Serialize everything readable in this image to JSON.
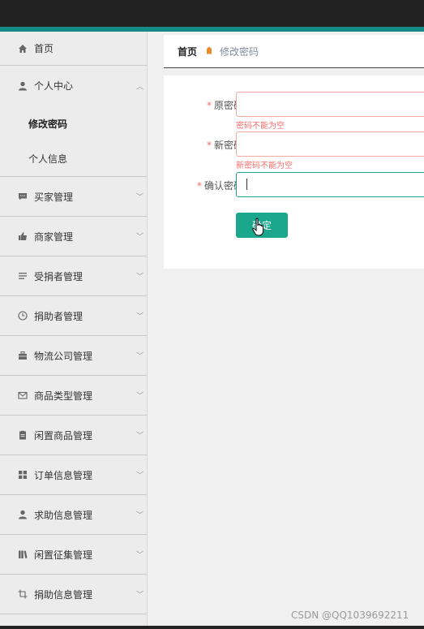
{
  "sidebar": {
    "items": [
      {
        "label": "首页",
        "icon": "home-icon"
      },
      {
        "label": "个人中心",
        "icon": "user-icon",
        "expanded": true,
        "children": [
          {
            "label": "修改密码",
            "active": true
          },
          {
            "label": "个人信息"
          }
        ]
      },
      {
        "label": "买家管理",
        "icon": "chat-icon"
      },
      {
        "label": "商家管理",
        "icon": "thumb-up-icon"
      },
      {
        "label": "受捐者管理",
        "icon": "list-icon"
      },
      {
        "label": "捐助者管理",
        "icon": "clock-icon"
      },
      {
        "label": "物流公司管理",
        "icon": "briefcase-icon"
      },
      {
        "label": "商品类型管理",
        "icon": "mail-icon"
      },
      {
        "label": "闲置商品管理",
        "icon": "clipboard-icon"
      },
      {
        "label": "订单信息管理",
        "icon": "grid-icon"
      },
      {
        "label": "求助信息管理",
        "icon": "user-icon"
      },
      {
        "label": "闲置征集管理",
        "icon": "books-icon"
      },
      {
        "label": "捐助信息管理",
        "icon": "crop-icon"
      }
    ]
  },
  "breadcrumb": {
    "home": "首页",
    "current": "修改密码"
  },
  "form": {
    "old_password": {
      "label": "原密码",
      "required_mark": "*",
      "value": "",
      "error": "密码不能为空"
    },
    "new_password": {
      "label": "新密码",
      "required_mark": "*",
      "value": "",
      "error": "新密码不能为空"
    },
    "confirm_password": {
      "label": "确认密码",
      "required_mark": "*",
      "value": ""
    },
    "submit_label": "确定"
  },
  "watermark": "CSDN @QQ1039692211",
  "colors": {
    "accent": "#1ba68e",
    "error": "#f56c6c",
    "topbar": "#222222",
    "stripe": "#168a85"
  }
}
